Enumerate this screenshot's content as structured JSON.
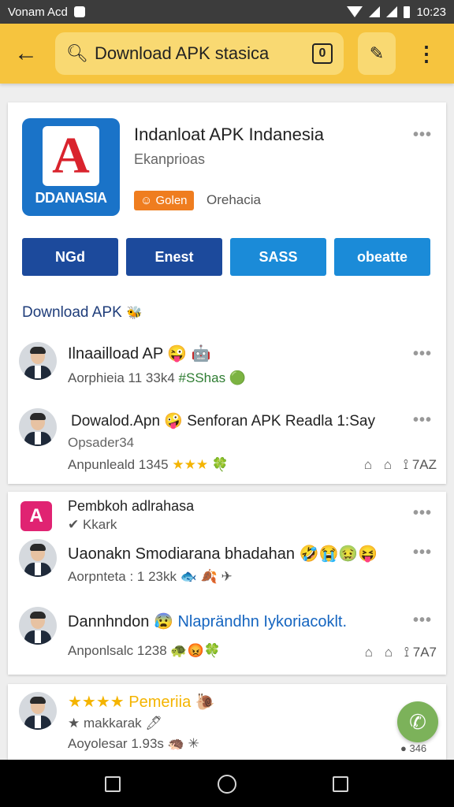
{
  "status_bar": {
    "carrier": "Vonam Acd",
    "time": "10:23"
  },
  "toolbar": {
    "search_value": "Download APK stasica",
    "clip_icon_label": "0"
  },
  "app": {
    "title": "Indanloat APK Indanesia",
    "subtitle": "Ekanprioas",
    "badge": "☺ Golen",
    "category": "Orehacia",
    "logo_letter": "A",
    "logo_text": "DDANASIA",
    "brand_color": "#1a73c8"
  },
  "buttons": [
    {
      "label": "NGd"
    },
    {
      "label": "Enest"
    },
    {
      "label": "SASS"
    },
    {
      "label": "obeatte"
    }
  ],
  "section": {
    "title": "Download APK",
    "emoji": "🐝"
  },
  "posts": [
    {
      "title": "Ilnaailload AP 😜 🤖",
      "meta_prefix": "Aorphieia 11 33k4",
      "meta_highlight": "#SShas 🟢"
    },
    {
      "title": "Dowalod.Apn 🤪 Senforan APK Readla 1:Say",
      "subtitle": "Opsader34",
      "meta_prefix": "Anpunleald 1345",
      "meta_stars": "★★★ 🍀",
      "actions": {
        "like": "⌂",
        "share": "⌂",
        "count": "⟟ 7AZ"
      }
    }
  ],
  "card2": {
    "header_title": "Pembkoh adlrahasa",
    "header_sub": "✔ Kkark",
    "icon_letter": "A",
    "posts": [
      {
        "title": "Uaonakn Smodiarana bhadahan 🤣😭🤢😝",
        "meta": "Aorpnteta : 1 23kk 🐟 🍂 ✈"
      },
      {
        "title": "Dannhndon 😰",
        "title_link": "Nlaprändhn Iykoriacoklt.",
        "meta": "Anponlsalc 1238 🐢😡🍀",
        "actions": {
          "like": "⌂",
          "share": "⌂",
          "count": "⟟ 7A7"
        }
      }
    ]
  },
  "card3": {
    "title": "★★★★ Pemeriia 🐌",
    "sub": "★ makkarak 🖊",
    "meta": "Aoyolesar 1.93s 🦔 ✳",
    "fab_count": "● 346"
  },
  "icons": {
    "back": "back-arrow-icon",
    "search": "search-icon",
    "menu": "more-vert-icon",
    "fab": "phone-icon"
  }
}
